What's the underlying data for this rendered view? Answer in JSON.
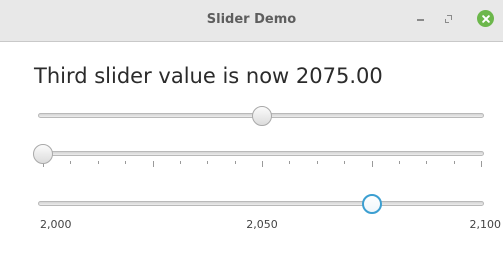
{
  "window": {
    "title": "Slider Demo",
    "controls": [
      "minimize",
      "restore",
      "close"
    ]
  },
  "status_label": "Third slider value is now 2075.00",
  "sliders": [
    {
      "name": "first",
      "min": 0,
      "max": 100,
      "value": 50,
      "show_ticks": false
    },
    {
      "name": "second",
      "min": 0,
      "max": 100,
      "value": 0,
      "show_ticks": true,
      "major_ticks": 4,
      "minor_per_major": 4
    },
    {
      "name": "third",
      "min": 2000,
      "max": 2100,
      "value": 2075,
      "show_ticks": false,
      "focused": true,
      "tick_labels": [
        "2,000",
        "2,050",
        "2,100"
      ]
    }
  ],
  "colors": {
    "focus_ring": "#3c9fd1",
    "close_button": "#6cb74b",
    "titlebar": "#e8e8e8"
  }
}
